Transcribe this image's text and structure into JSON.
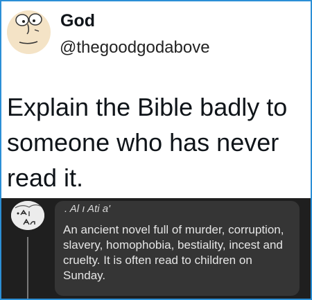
{
  "tweet": {
    "display_name": "God",
    "handle": "@thegoodgodabove",
    "text": "Explain the Bible badly to someone who has never read it."
  },
  "reply": {
    "author_name": ". Al ı Ati a'",
    "avatar_label": ". Al An",
    "text": "An ancient novel full of murder, corruption, slavery, homophobia, bestiality, incest and cruelty. It is often read to children on Sunday."
  },
  "colors": {
    "border": "#2b8fd6",
    "reply_background": "#1f1f1f",
    "bubble": "#353535"
  }
}
